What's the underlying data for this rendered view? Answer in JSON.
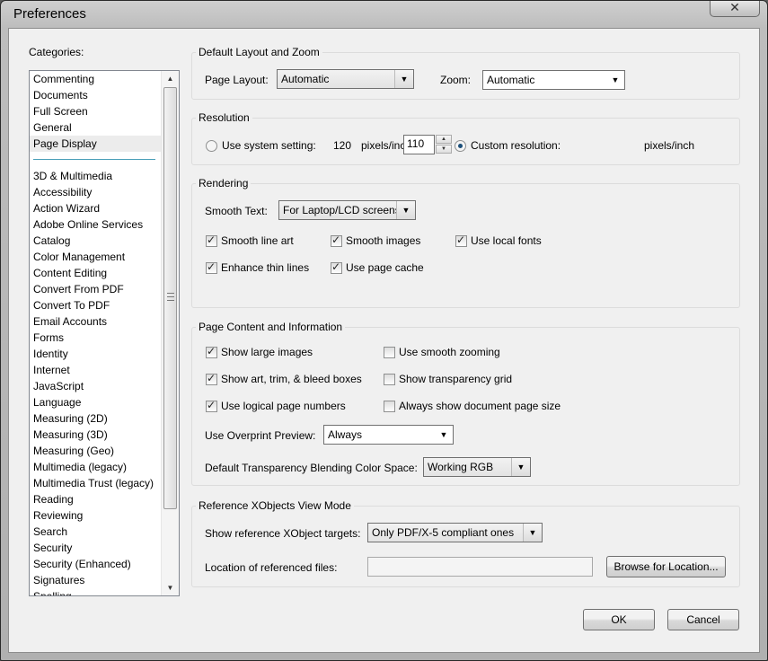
{
  "window": {
    "title": "Preferences",
    "close_glyph": "✕"
  },
  "categories": {
    "label": "Categories:",
    "top_items": [
      {
        "label": "Commenting",
        "selected": false
      },
      {
        "label": "Documents",
        "selected": false
      },
      {
        "label": "Full Screen",
        "selected": false
      },
      {
        "label": "General",
        "selected": false
      },
      {
        "label": "Page Display",
        "selected": true
      }
    ],
    "items": [
      "3D & Multimedia",
      "Accessibility",
      "Action Wizard",
      "Adobe Online Services",
      "Catalog",
      "Color Management",
      "Content Editing",
      "Convert From PDF",
      "Convert To PDF",
      "Email Accounts",
      "Forms",
      "Identity",
      "Internet",
      "JavaScript",
      "Language",
      "Measuring (2D)",
      "Measuring (3D)",
      "Measuring (Geo)",
      "Multimedia (legacy)",
      "Multimedia Trust (legacy)",
      "Reading",
      "Reviewing",
      "Search",
      "Security",
      "Security (Enhanced)",
      "Signatures",
      "Spelling"
    ]
  },
  "layout_zoom": {
    "title": "Default Layout and Zoom",
    "page_layout_label": "Page Layout:",
    "page_layout_value": "Automatic",
    "zoom_label": "Zoom:",
    "zoom_value": "Automatic"
  },
  "resolution": {
    "title": "Resolution",
    "system_label": "Use system setting:",
    "system_value": "120",
    "system_unit": "pixels/inch",
    "system_checked": false,
    "custom_label": "Custom resolution:",
    "custom_value": "110",
    "custom_unit": "pixels/inch",
    "custom_checked": true
  },
  "rendering": {
    "title": "Rendering",
    "smooth_text_label": "Smooth Text:",
    "smooth_text_value": "For Laptop/LCD screens",
    "smooth_line_art": {
      "label": "Smooth line art",
      "checked": true
    },
    "smooth_images": {
      "label": "Smooth images",
      "checked": true
    },
    "use_local_fonts": {
      "label": "Use local fonts",
      "checked": true
    },
    "enhance_thin_lines": {
      "label": "Enhance thin lines",
      "checked": true
    },
    "use_page_cache": {
      "label": "Use page cache",
      "checked": true
    }
  },
  "page_content": {
    "title": "Page Content and Information",
    "show_large_images": {
      "label": "Show large images",
      "checked": true
    },
    "use_smooth_zooming": {
      "label": "Use smooth zooming",
      "checked": false
    },
    "show_art_boxes": {
      "label": "Show art, trim, & bleed boxes",
      "checked": true
    },
    "show_transparency_grid": {
      "label": "Show transparency grid",
      "checked": false
    },
    "use_logical_page_numbers": {
      "label": "Use logical page numbers",
      "checked": true
    },
    "always_show_page_size": {
      "label": "Always show document page size",
      "checked": false
    },
    "overprint_label": "Use Overprint Preview:",
    "overprint_value": "Always",
    "blending_label": "Default Transparency Blending Color Space:",
    "blending_value": "Working RGB"
  },
  "xobjects": {
    "title": "Reference XObjects View Mode",
    "targets_label": "Show reference XObject targets:",
    "targets_value": "Only PDF/X-5 compliant ones",
    "location_label": "Location of referenced files:",
    "location_value": "",
    "browse_label": "Browse for Location..."
  },
  "footer": {
    "ok_label": "OK",
    "cancel_label": "Cancel"
  }
}
